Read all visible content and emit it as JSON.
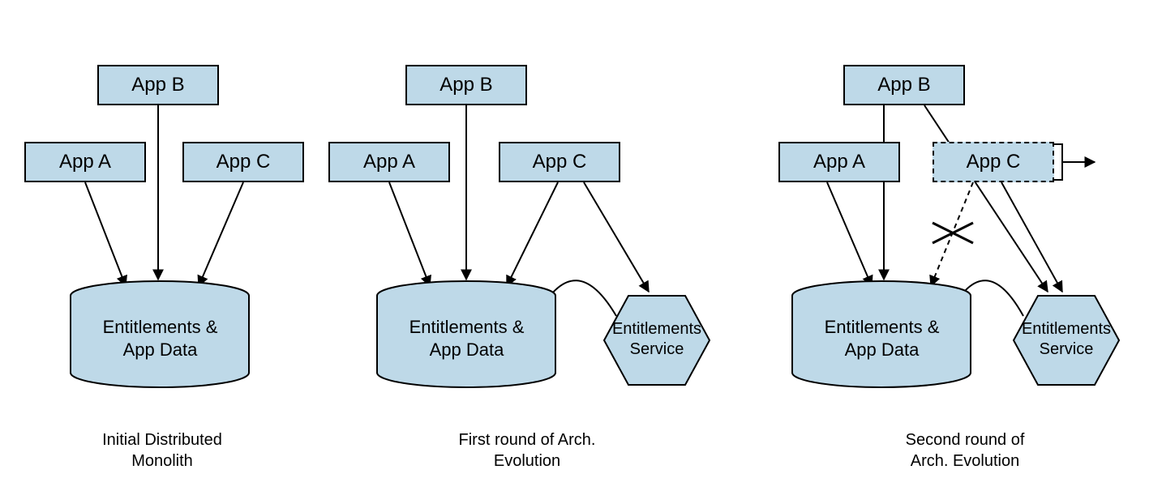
{
  "apps": {
    "a": "App A",
    "b": "App B",
    "c": "App C"
  },
  "cylinder": {
    "line1": "Entitlements &",
    "line2": "App Data"
  },
  "hexagon": {
    "line1": "Entitlements",
    "line2": "Service"
  },
  "captions": {
    "left": {
      "l1": "Initial Distributed",
      "l2": "Monolith"
    },
    "middle": {
      "l1": "First round of Arch.",
      "l2": "Evolution"
    },
    "right": {
      "l1": "Second round of",
      "l2": "Arch. Evolution"
    }
  }
}
